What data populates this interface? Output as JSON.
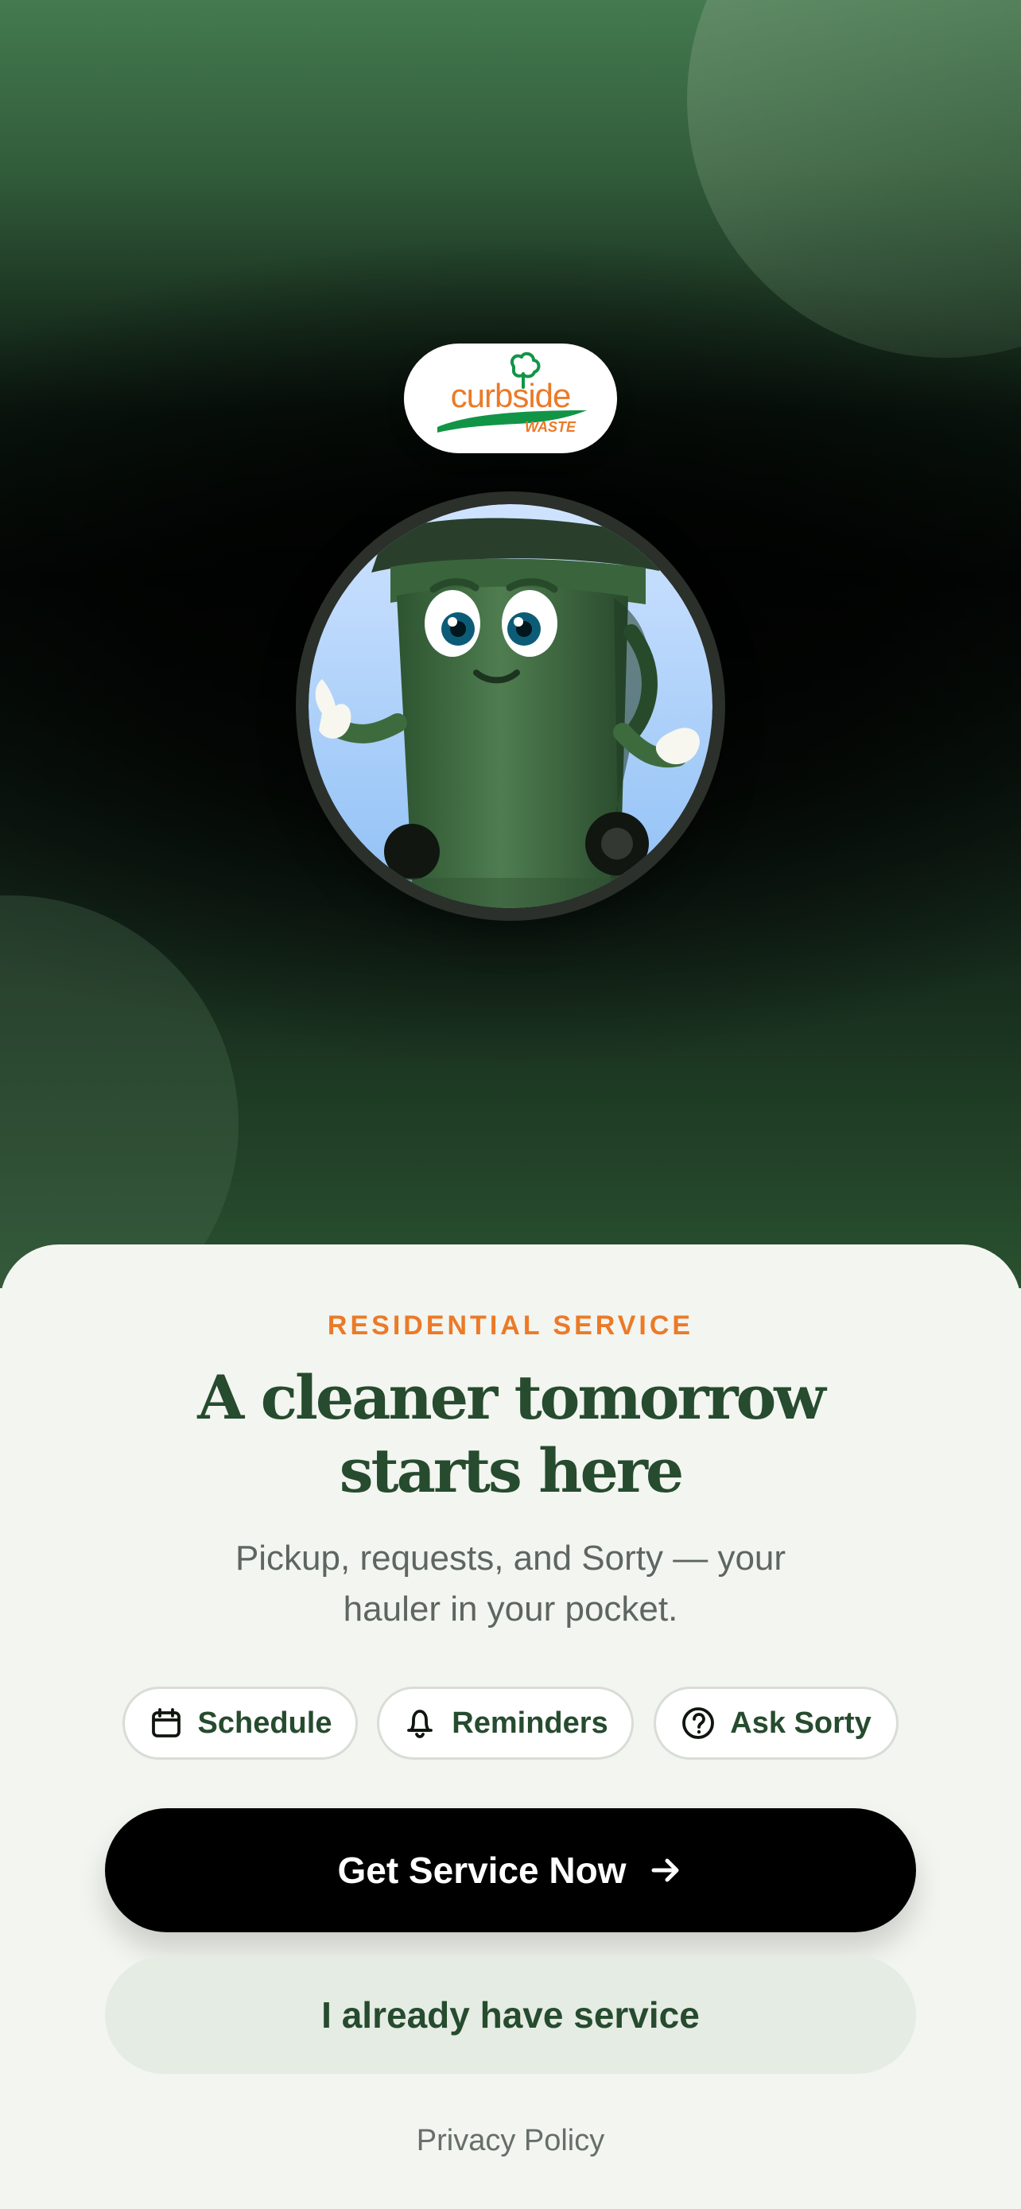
{
  "brand": {
    "logo_text": "curbside",
    "logo_subtext": "WASTE",
    "logo_primary_color": "#eb7a28",
    "logo_green_color": "#129447"
  },
  "hero": {
    "mascot": "smiling green trash bin mascot",
    "background_colors": [
      "#447a4f",
      "#040906",
      "#2a5130"
    ]
  },
  "content": {
    "eyebrow": "RESIDENTIAL SERVICE",
    "headline_line_1": "A cleaner tomorrow",
    "headline_line_2": "starts here",
    "subhead_line_1": "Pickup, requests, and Sorty — your",
    "subhead_line_2": "hauler in your pocket."
  },
  "features": [
    {
      "icon": "calendar-icon",
      "label": "Schedule"
    },
    {
      "icon": "bell-icon",
      "label": "Reminders"
    },
    {
      "icon": "question-circle-icon",
      "label": "Ask Sorty"
    }
  ],
  "actions": {
    "primary": "Get Service Now",
    "primary_icon": "arrow-right-icon",
    "secondary": "I already have service",
    "privacy": "Privacy Policy"
  },
  "colors": {
    "accent": "#eb7a28",
    "dark_green": "#264b2e",
    "primary_button": "#000000",
    "secondary_button": "#e5ece4"
  }
}
